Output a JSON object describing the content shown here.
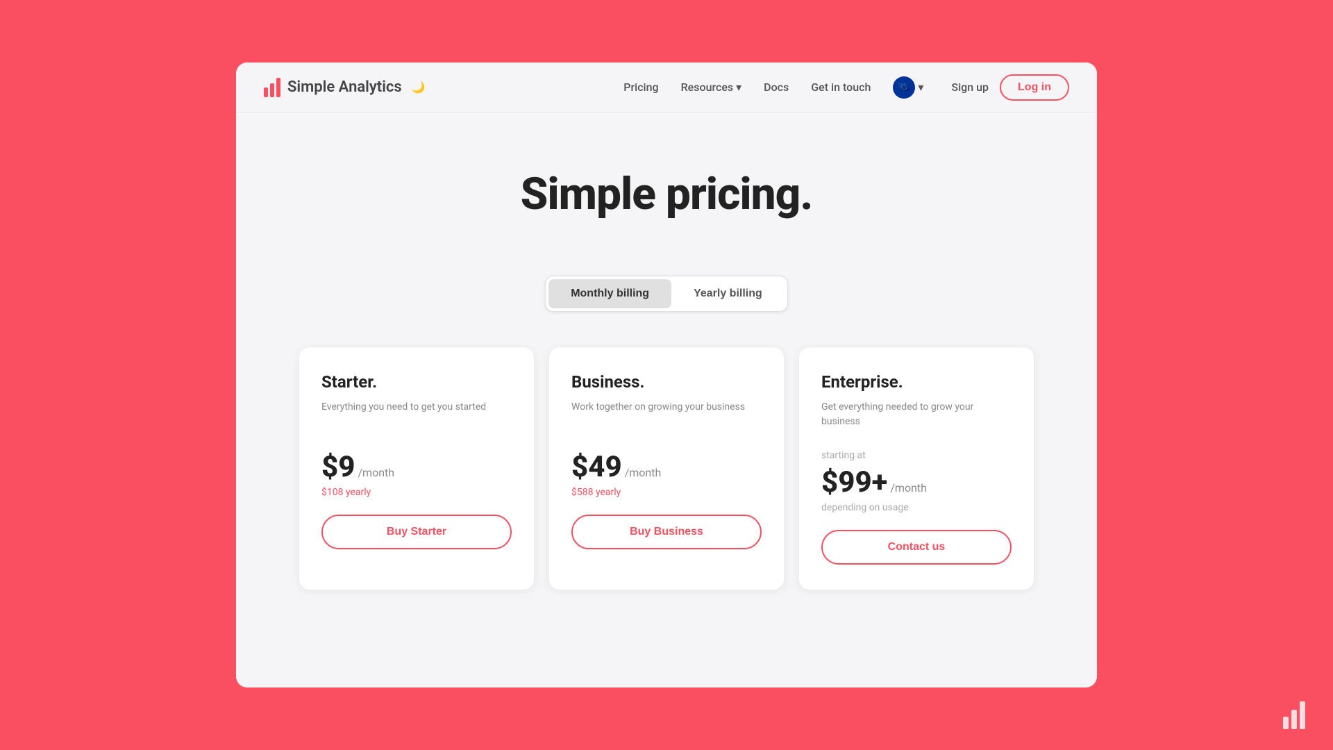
{
  "brand": {
    "name": "Simple Analytics",
    "logo_alt": "Simple Analytics logo"
  },
  "nav": {
    "pricing_label": "Pricing",
    "resources_label": "Resources",
    "docs_label": "Docs",
    "get_in_touch_label": "Get in touch",
    "signup_label": "Sign up",
    "login_label": "Log in"
  },
  "hero": {
    "title": "Simple pricing."
  },
  "billing_toggle": {
    "monthly_label": "Monthly billing",
    "yearly_label": "Yearly billing",
    "active": "monthly"
  },
  "plans": [
    {
      "id": "starter",
      "name": "Starter.",
      "description": "Everything you need to get you started",
      "price": "$9",
      "period": "/month",
      "yearly": "$108 yearly",
      "button_label": "Buy Starter",
      "starting_at": "",
      "depending": ""
    },
    {
      "id": "business",
      "name": "Business.",
      "description": "Work together on growing your business",
      "price": "$49",
      "period": "/month",
      "yearly": "$588 yearly",
      "button_label": "Buy Business",
      "starting_at": "",
      "depending": ""
    },
    {
      "id": "enterprise",
      "name": "Enterprise.",
      "description": "Get everything needed to grow your business",
      "price": "$99+",
      "period": "/month",
      "yearly": "",
      "button_label": "Contact us",
      "starting_at": "starting at",
      "depending": "depending on usage"
    }
  ]
}
